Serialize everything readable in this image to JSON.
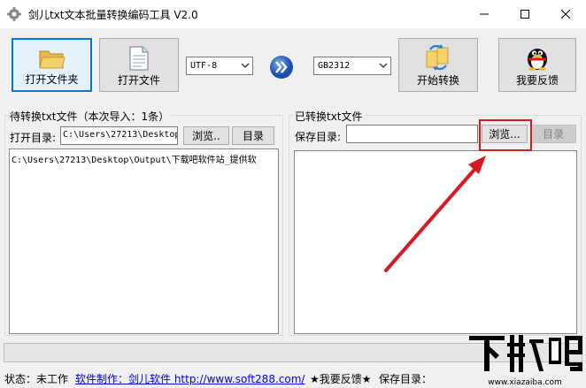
{
  "window": {
    "title": "剑儿txt文本批量转换编码工具 V2.0",
    "controls": [
      "minimize",
      "maximize",
      "close"
    ]
  },
  "toolbar": {
    "open_folder_label": "打开文件夹",
    "open_file_label": "打开文件",
    "source_encoding": "UTF-8",
    "target_encoding": "GB2312",
    "start_convert_label": "开始转换",
    "feedback_label": "我要反馈",
    "convert_arrow_icon": "double-chevron-right-icon"
  },
  "left_panel": {
    "group_title": "待转换txt文件（本次导入：1条）",
    "open_dir_label": "打开目录:",
    "open_dir_value": "C:\\Users\\27213\\Desktop",
    "browse_label": "浏览..",
    "dir_button_label": "目录",
    "files": [
      "C:\\Users\\27213\\Desktop\\Output\\下载吧软件站_提供软"
    ]
  },
  "right_panel": {
    "group_title": "已转换txt文件",
    "save_dir_label": "保存目录:",
    "save_dir_value": "",
    "browse_label": "浏览...",
    "dir_button_label": "目录",
    "files": []
  },
  "status": {
    "state_label": "状态：",
    "state_value": "未工作",
    "maker_link": "软件制作：剑儿软件  http://www.soft288.com/",
    "feedback_link": "★我要反馈★",
    "save_dir_label": "保存目录："
  },
  "progress": {
    "value": 0
  },
  "watermark": {
    "logo_text": "下载吧",
    "url_text": "www.xiazaiba.com"
  },
  "colors": {
    "accent": "#0078d7",
    "highlight": "#d71920",
    "annotation_arrow": "#d71920",
    "link": "#0000ee"
  }
}
